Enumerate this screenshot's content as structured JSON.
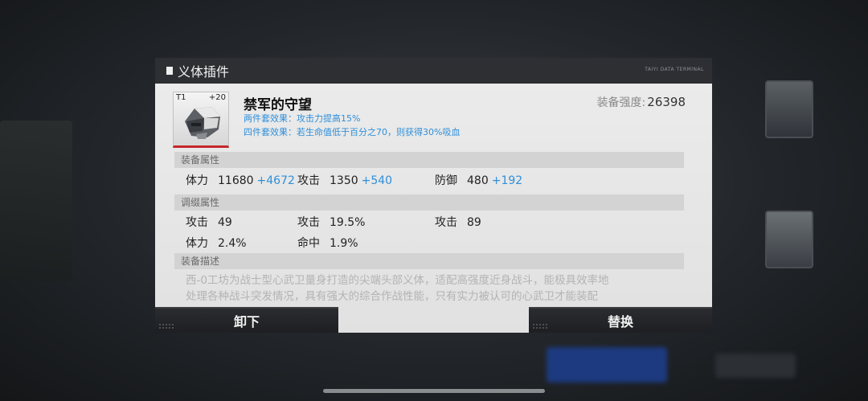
{
  "dialog": {
    "title": "义体插件",
    "terminal_label": "TAIYI DATA TERMINAL"
  },
  "item": {
    "tier": "T1",
    "level": "+20",
    "name": "禁军的守望",
    "set_bonus_2": "两件套效果：攻击力提高15%",
    "set_bonus_4": "四件套效果：若生命值低于百分之70，则获得30%吸血",
    "power_label": "装备强度:",
    "power_value": "26398"
  },
  "sections": {
    "equip_attr": "装备属性",
    "tune_attr": "调缀属性",
    "desc": "装备描述"
  },
  "equip_stats": [
    {
      "name": "体力",
      "value": "11680",
      "bonus": "+4672"
    },
    {
      "name": "攻击",
      "value": "1350",
      "bonus": "+540"
    },
    {
      "name": "防御",
      "value": "480",
      "bonus": "+192"
    }
  ],
  "tune_stats": [
    {
      "name": "攻击",
      "value": "49"
    },
    {
      "name": "攻击",
      "value": "19.5%"
    },
    {
      "name": "攻击",
      "value": "89"
    },
    {
      "name": "体力",
      "value": "2.4%"
    },
    {
      "name": "命中",
      "value": "1.9%"
    }
  ],
  "description": {
    "line1": "西-0工坊为战士型心武卫量身打造的尖端头部义体，适配高强度近身战斗，能极具效率地",
    "line2": "处理各种战斗突发情况，具有强大的综合作战性能，只有实力被认可的心武卫才能装配"
  },
  "buttons": {
    "unequip": "卸下",
    "replace": "替换"
  },
  "colors": {
    "accent_blue": "#2f8fda",
    "rarity_red": "#c6272b",
    "header_dark": "#2d2f33"
  }
}
